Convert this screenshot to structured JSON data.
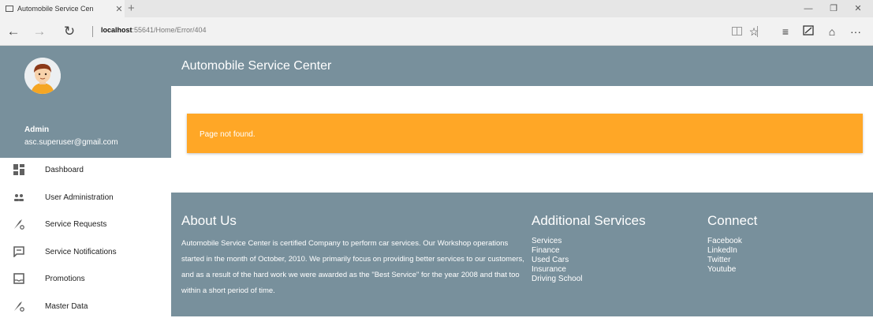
{
  "browser": {
    "tab_title": "Automobile Service Cen",
    "address_host": "localhost",
    "address_port_path": ":55641/Home/Error/404"
  },
  "sidebar": {
    "user_name": "Admin",
    "user_email": "asc.superuser@gmail.com",
    "items": [
      {
        "label": "Dashboard",
        "icon": "dashboard-icon"
      },
      {
        "label": "User Administration",
        "icon": "users-icon"
      },
      {
        "label": "Service Requests",
        "icon": "wrench-icon"
      },
      {
        "label": "Service Notifications",
        "icon": "message-icon"
      },
      {
        "label": "Promotions",
        "icon": "inbox-icon"
      },
      {
        "label": "Master Data",
        "icon": "wrench-icon"
      }
    ]
  },
  "header": {
    "title": "Automobile Service Center"
  },
  "alert": {
    "message": "Page not found."
  },
  "footer": {
    "about_title": "About Us",
    "about_text": "Automobile Service Center is certified Company to perform car services. Our Workshop operations started in the month of October, 2010. We primarily focus on providing better services to our customers, and as a result of the hard work we were awarded as the \"Best Service\" for the year 2008 and that too within a short period of time.",
    "services_title": "Additional Services",
    "services": [
      "Services",
      "Finance",
      "Used Cars",
      "Insurance",
      "Driving School"
    ],
    "connect_title": "Connect",
    "connect": [
      "Facebook",
      "LinkedIn",
      "Twitter",
      "Youtube"
    ]
  },
  "colors": {
    "primary": "#78909c",
    "warning": "#ffa726"
  }
}
